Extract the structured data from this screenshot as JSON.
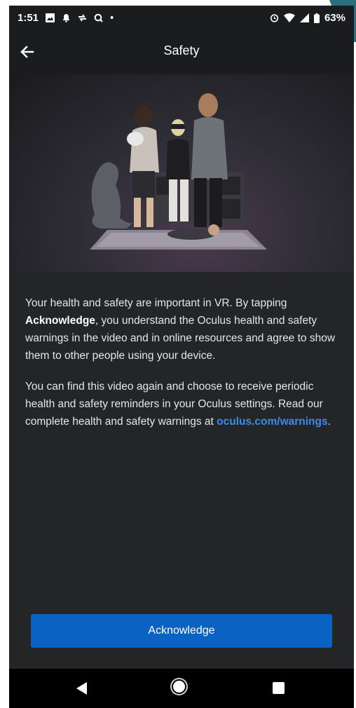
{
  "status_bar": {
    "time": "1:51",
    "dot": "•",
    "battery_percent": "63%",
    "icons": [
      "gallery-icon",
      "notification-icon",
      "sync-icon",
      "search-app-icon",
      "alarm-icon",
      "wifi-icon",
      "signal-icon",
      "battery-icon"
    ]
  },
  "app_bar": {
    "title": "Safety",
    "back_icon": "arrow-left-icon"
  },
  "body": {
    "p1_before": "Your health and safety are important in VR. By tapping ",
    "p1_bold": "Acknowledge",
    "p1_after": ", you understand the Oculus health and safety warnings in the video and in online resources and agree to show them to other people using your device.",
    "p2_before": "You can find this video again and choose to receive periodic health and safety reminders in your Oculus settings. Read our complete health and safety warnings at ",
    "p2_link": "oculus.com/warnings",
    "p2_after": "."
  },
  "actions": {
    "acknowledge_label": "Acknowledge"
  },
  "colors": {
    "background": "#242527",
    "primary_button": "#0a63c2",
    "link": "#3a8cf0"
  },
  "nav_bar": {
    "icons": [
      "nav-back-icon",
      "nav-home-icon",
      "nav-recents-icon"
    ]
  }
}
